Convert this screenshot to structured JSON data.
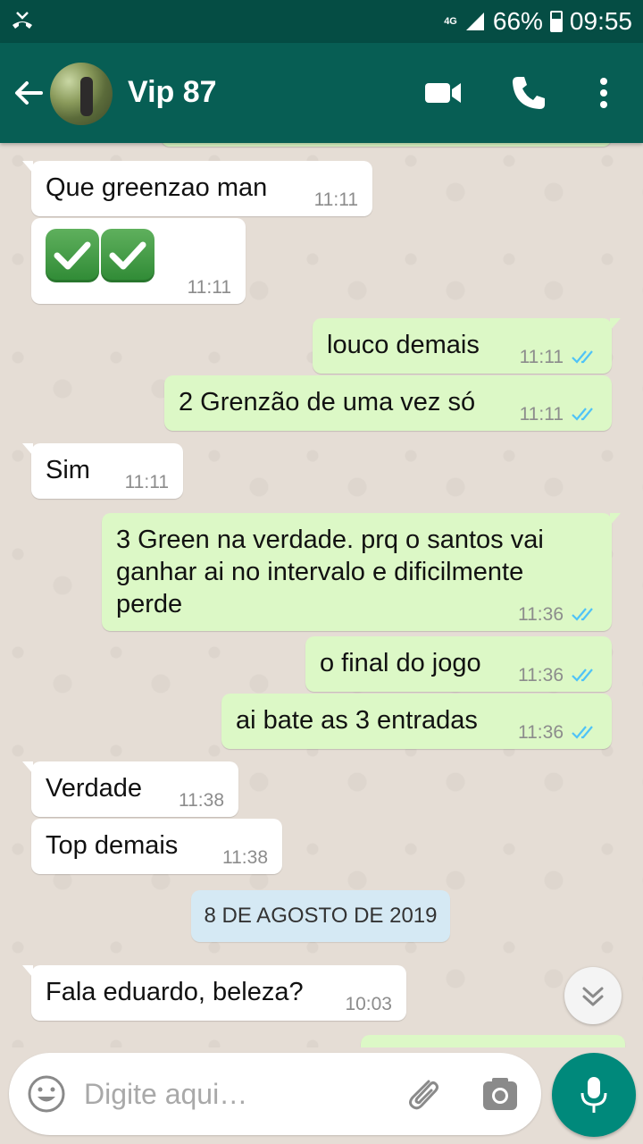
{
  "status_bar": {
    "network": "4G",
    "battery": "66%",
    "time": "09:55"
  },
  "header": {
    "contact_name": "Vip 87"
  },
  "messages": [
    {
      "dir": "in",
      "text": "Que greenzao man",
      "time": "11:11"
    },
    {
      "dir": "in",
      "emoji": [
        "white-heavy-check-mark",
        "white-heavy-check-mark"
      ],
      "time": "11:11"
    },
    {
      "dir": "out",
      "text": "louco demais",
      "time": "11:11",
      "status": "read"
    },
    {
      "dir": "out",
      "text": "2 Grenzão de uma vez só",
      "time": "11:11",
      "status": "read"
    },
    {
      "dir": "in",
      "text": "Sim",
      "time": "11:11"
    },
    {
      "dir": "out",
      "text": "3 Green na verdade. prq o santos vai ganhar ai no intervalo e dificilmente perde",
      "time": "11:36",
      "status": "read"
    },
    {
      "dir": "out",
      "text": "o final do jogo",
      "time": "11:36",
      "status": "read"
    },
    {
      "dir": "out",
      "text": "ai bate as 3 entradas",
      "time": "11:36",
      "status": "read"
    },
    {
      "dir": "in",
      "text": "Verdade",
      "time": "11:38"
    },
    {
      "dir": "in",
      "text": "Top demais",
      "time": "11:38"
    },
    {
      "dir": "in",
      "text": "Fala eduardo, beleza?",
      "time": "10:03"
    }
  ],
  "date_separator": "8 DE AGOSTO DE 2019",
  "composer": {
    "placeholder": "Digite aqui…"
  },
  "colors": {
    "header": "#075e54",
    "status_bar": "#054d44",
    "outgoing": "#dcf8c6",
    "incoming": "#ffffff",
    "read_ticks": "#4fc3f7",
    "mic": "#00897b"
  }
}
